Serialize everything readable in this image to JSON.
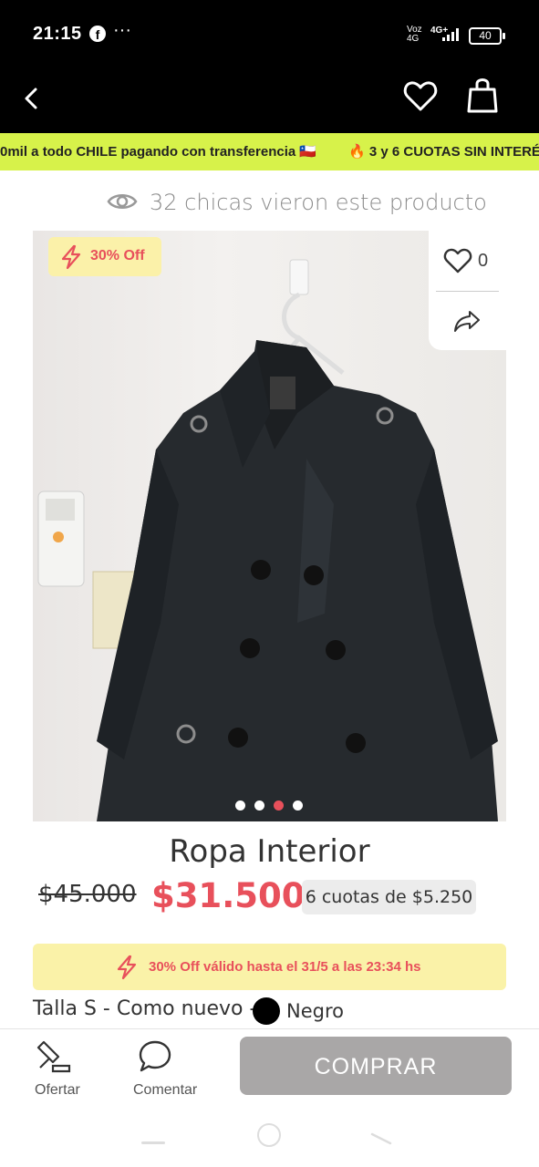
{
  "status_bar": {
    "time": "21:15",
    "dots": "···",
    "network_label": "Voz 4G",
    "network_type": "4G+",
    "battery": "40"
  },
  "promo_banner": {
    "message_1": "0mil a todo CHILE pagando con transferencia 🇨🇱",
    "message_2": "🔥 3 y 6 CUOTAS SIN INTERÉS"
  },
  "viewers": {
    "text": "32 chicas vieron este producto"
  },
  "product": {
    "discount_badge": "30% Off",
    "likes": "0",
    "image_count": 4,
    "active_image_index": 2,
    "title": "Ropa Interior",
    "old_price": "$45.000",
    "price": "$31.500",
    "installments": "6 cuotas de $5.250",
    "promo_text": "30% Off válido hasta el 31/5 a las 23:34 hs",
    "details": "Talla S - Como nuevo -",
    "color_name": "Negro",
    "color_hex": "#000000"
  },
  "actions": {
    "offer_label": "Ofertar",
    "comment_label": "Comentar",
    "buy_label": "COMPRAR"
  },
  "colors": {
    "accent_red": "#e8505b",
    "banner_green": "#d7f24a",
    "promo_yellow": "#faf2a8",
    "buy_disabled": "#a9a7a7"
  }
}
